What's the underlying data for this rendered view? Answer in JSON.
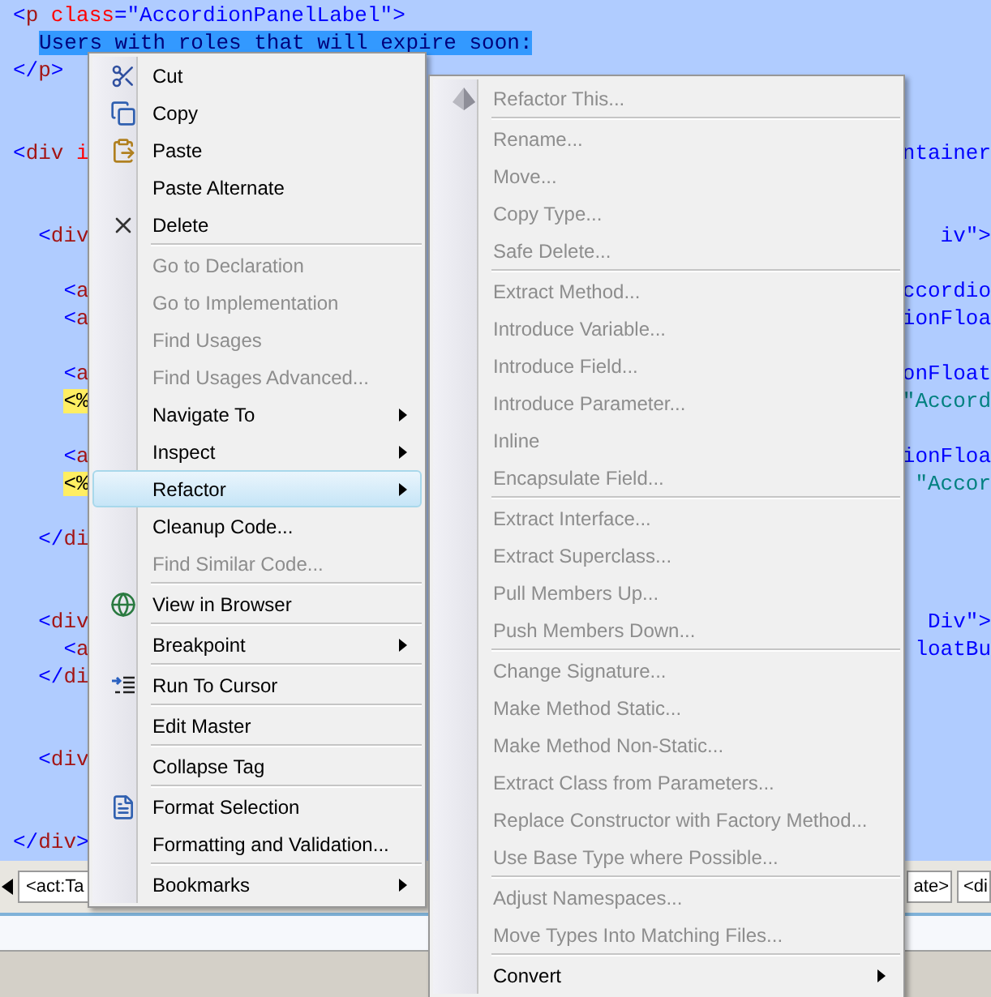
{
  "editor": {
    "lines": [
      {
        "kind": "code",
        "left": [
          {
            "kind": "punct",
            "text": "<"
          },
          {
            "kind": "tag",
            "text": "p"
          },
          {
            "kind": "attr",
            "text": " class"
          },
          {
            "kind": "punct",
            "text": "="
          },
          {
            "kind": "value",
            "text": "\"AccordionPanelLabel\""
          },
          {
            "kind": "punct",
            "text": ">"
          }
        ]
      },
      {
        "kind": "code",
        "indented": true,
        "left": [
          {
            "kind": "selected",
            "text": "Users with roles that will expire soon:"
          }
        ]
      },
      {
        "kind": "code",
        "left": [
          {
            "kind": "punct",
            "text": "</"
          },
          {
            "kind": "tag",
            "text": "p"
          },
          {
            "kind": "punct",
            "text": ">"
          }
        ]
      },
      {
        "kind": "blank"
      },
      {
        "kind": "blank"
      },
      {
        "kind": "code",
        "left": [
          {
            "kind": "punct",
            "text": "<"
          },
          {
            "kind": "tag",
            "text": "div"
          },
          {
            "kind": "attr",
            "text": " i"
          }
        ],
        "right": [
          {
            "kind": "value",
            "text": "ntainer"
          }
        ]
      },
      {
        "kind": "blank"
      },
      {
        "kind": "blank"
      },
      {
        "kind": "code",
        "left": [
          {
            "kind": "punct",
            "text": "  <"
          },
          {
            "kind": "tag",
            "text": "div"
          }
        ],
        "right": [
          {
            "kind": "value",
            "text": "iv\">"
          }
        ]
      },
      {
        "kind": "blank"
      },
      {
        "kind": "code",
        "left": [
          {
            "kind": "punct",
            "text": "    <"
          },
          {
            "kind": "tag",
            "text": "a"
          }
        ],
        "right": [
          {
            "kind": "value",
            "text": "ccordio"
          }
        ]
      },
      {
        "kind": "code",
        "left": [
          {
            "kind": "punct",
            "text": "    <"
          },
          {
            "kind": "tag",
            "text": "a"
          }
        ],
        "right": [
          {
            "kind": "value",
            "text": "ionFloa"
          }
        ]
      },
      {
        "kind": "blank"
      },
      {
        "kind": "code",
        "left": [
          {
            "kind": "punct",
            "text": "    <"
          },
          {
            "kind": "tag",
            "text": "a"
          }
        ],
        "right": [
          {
            "kind": "value",
            "text": "onFloat"
          }
        ]
      },
      {
        "kind": "code",
        "left": [
          {
            "kind": "server",
            "text": "    <%"
          }
        ],
        "right": [
          {
            "kind": "string",
            "text": "\"Accord"
          }
        ]
      },
      {
        "kind": "blank"
      },
      {
        "kind": "code",
        "left": [
          {
            "kind": "punct",
            "text": "    <"
          },
          {
            "kind": "tag",
            "text": "a"
          }
        ],
        "right": [
          {
            "kind": "value",
            "text": "ionFloa"
          }
        ]
      },
      {
        "kind": "code",
        "left": [
          {
            "kind": "server",
            "text": "    <%"
          }
        ],
        "right": [
          {
            "kind": "string",
            "text": "\"Accor"
          }
        ]
      },
      {
        "kind": "blank"
      },
      {
        "kind": "code",
        "left": [
          {
            "kind": "punct",
            "text": "  </"
          },
          {
            "kind": "tag",
            "text": "di"
          }
        ]
      },
      {
        "kind": "blank"
      },
      {
        "kind": "blank"
      },
      {
        "kind": "code",
        "left": [
          {
            "kind": "punct",
            "text": "  <"
          },
          {
            "kind": "tag",
            "text": "div"
          }
        ],
        "right": [
          {
            "kind": "value",
            "text": "Div\">"
          }
        ]
      },
      {
        "kind": "code",
        "left": [
          {
            "kind": "punct",
            "text": "    <"
          },
          {
            "kind": "tag",
            "text": "a"
          }
        ],
        "right": [
          {
            "kind": "value",
            "text": "loatBu"
          }
        ]
      },
      {
        "kind": "code",
        "left": [
          {
            "kind": "punct",
            "text": "  </"
          },
          {
            "kind": "tag",
            "text": "di"
          }
        ]
      },
      {
        "kind": "blank"
      },
      {
        "kind": "blank"
      },
      {
        "kind": "code",
        "left": [
          {
            "kind": "punct",
            "text": "  <"
          },
          {
            "kind": "tag",
            "text": "div"
          }
        ]
      },
      {
        "kind": "blank"
      },
      {
        "kind": "blank"
      },
      {
        "kind": "code",
        "left": [
          {
            "kind": "punct",
            "text": "</"
          },
          {
            "kind": "tag",
            "text": "div"
          },
          {
            "kind": "punct",
            "text": ">"
          }
        ]
      }
    ]
  },
  "tag_bar": {
    "left_tag": "<act:Ta",
    "right_tags": [
      "ate>",
      "<di"
    ]
  },
  "context_menu": {
    "items": [
      {
        "kind": "item",
        "label": "Cut",
        "disabled": false,
        "selected": false,
        "submenu": false
      },
      {
        "kind": "item",
        "label": "Copy",
        "disabled": false,
        "selected": false,
        "submenu": false
      },
      {
        "kind": "item",
        "label": "Paste",
        "disabled": false,
        "selected": false,
        "submenu": false
      },
      {
        "kind": "item",
        "label": "Paste Alternate",
        "disabled": false,
        "selected": false,
        "submenu": false
      },
      {
        "kind": "item",
        "label": "Delete",
        "disabled": false,
        "selected": false,
        "submenu": false
      },
      {
        "kind": "separator"
      },
      {
        "kind": "item",
        "label": "Go to Declaration",
        "disabled": true,
        "selected": false,
        "submenu": false
      },
      {
        "kind": "item",
        "label": "Go to Implementation",
        "disabled": true,
        "selected": false,
        "submenu": false
      },
      {
        "kind": "item",
        "label": "Find Usages",
        "disabled": true,
        "selected": false,
        "submenu": false
      },
      {
        "kind": "item",
        "label": "Find Usages Advanced...",
        "disabled": true,
        "selected": false,
        "submenu": false
      },
      {
        "kind": "item",
        "label": "Navigate To",
        "disabled": false,
        "selected": false,
        "submenu": true
      },
      {
        "kind": "item",
        "label": "Inspect",
        "disabled": false,
        "selected": false,
        "submenu": true
      },
      {
        "kind": "item",
        "label": "Refactor",
        "disabled": false,
        "selected": true,
        "submenu": true
      },
      {
        "kind": "item",
        "label": "Cleanup Code...",
        "disabled": false,
        "selected": false,
        "submenu": false
      },
      {
        "kind": "item",
        "label": "Find Similar Code...",
        "disabled": true,
        "selected": false,
        "submenu": false
      },
      {
        "kind": "separator"
      },
      {
        "kind": "item",
        "label": "View in Browser",
        "disabled": false,
        "selected": false,
        "submenu": false
      },
      {
        "kind": "separator"
      },
      {
        "kind": "item",
        "label": "Breakpoint",
        "disabled": false,
        "selected": false,
        "submenu": true
      },
      {
        "kind": "separator"
      },
      {
        "kind": "item",
        "label": "Run To Cursor",
        "disabled": false,
        "selected": false,
        "submenu": false
      },
      {
        "kind": "separator"
      },
      {
        "kind": "item",
        "label": "Edit Master",
        "disabled": false,
        "selected": false,
        "submenu": false
      },
      {
        "kind": "separator"
      },
      {
        "kind": "item",
        "label": "Collapse Tag",
        "disabled": false,
        "selected": false,
        "submenu": false
      },
      {
        "kind": "separator"
      },
      {
        "kind": "item",
        "label": "Format Selection",
        "disabled": false,
        "selected": false,
        "submenu": false
      },
      {
        "kind": "item",
        "label": "Formatting and Validation...",
        "disabled": false,
        "selected": false,
        "submenu": false
      },
      {
        "kind": "separator"
      },
      {
        "kind": "item",
        "label": "Bookmarks",
        "disabled": false,
        "selected": false,
        "submenu": true
      }
    ]
  },
  "refactor_submenu": {
    "items": [
      {
        "kind": "item",
        "label": "Refactor This...",
        "disabled": true,
        "selected": false,
        "submenu": false
      },
      {
        "kind": "separator"
      },
      {
        "kind": "item",
        "label": "Rename...",
        "disabled": true,
        "selected": false,
        "submenu": false
      },
      {
        "kind": "item",
        "label": "Move...",
        "disabled": true,
        "selected": false,
        "submenu": false
      },
      {
        "kind": "item",
        "label": "Copy Type...",
        "disabled": true,
        "selected": false,
        "submenu": false
      },
      {
        "kind": "item",
        "label": "Safe Delete...",
        "disabled": true,
        "selected": false,
        "submenu": false
      },
      {
        "kind": "separator"
      },
      {
        "kind": "item",
        "label": "Extract Method...",
        "disabled": true,
        "selected": false,
        "submenu": false
      },
      {
        "kind": "item",
        "label": "Introduce Variable...",
        "disabled": true,
        "selected": false,
        "submenu": false
      },
      {
        "kind": "item",
        "label": "Introduce Field...",
        "disabled": true,
        "selected": false,
        "submenu": false
      },
      {
        "kind": "item",
        "label": "Introduce Parameter...",
        "disabled": true,
        "selected": false,
        "submenu": false
      },
      {
        "kind": "item",
        "label": "Inline",
        "disabled": true,
        "selected": false,
        "submenu": false
      },
      {
        "kind": "item",
        "label": "Encapsulate Field...",
        "disabled": true,
        "selected": false,
        "submenu": false
      },
      {
        "kind": "separator"
      },
      {
        "kind": "item",
        "label": "Extract Interface...",
        "disabled": true,
        "selected": false,
        "submenu": false
      },
      {
        "kind": "item",
        "label": "Extract Superclass...",
        "disabled": true,
        "selected": false,
        "submenu": false
      },
      {
        "kind": "item",
        "label": "Pull Members Up...",
        "disabled": true,
        "selected": false,
        "submenu": false
      },
      {
        "kind": "item",
        "label": "Push Members Down...",
        "disabled": true,
        "selected": false,
        "submenu": false
      },
      {
        "kind": "separator"
      },
      {
        "kind": "item",
        "label": "Change Signature...",
        "disabled": true,
        "selected": false,
        "submenu": false
      },
      {
        "kind": "item",
        "label": "Make Method Static...",
        "disabled": true,
        "selected": false,
        "submenu": false
      },
      {
        "kind": "item",
        "label": "Make Method Non-Static...",
        "disabled": true,
        "selected": false,
        "submenu": false
      },
      {
        "kind": "item",
        "label": "Extract Class from Parameters...",
        "disabled": true,
        "selected": false,
        "submenu": false
      },
      {
        "kind": "item",
        "label": "Replace Constructor with Factory Method...",
        "disabled": true,
        "selected": false,
        "submenu": false
      },
      {
        "kind": "item",
        "label": "Use Base Type where Possible...",
        "disabled": true,
        "selected": false,
        "submenu": false
      },
      {
        "kind": "separator"
      },
      {
        "kind": "item",
        "label": "Adjust Namespaces...",
        "disabled": true,
        "selected": false,
        "submenu": false
      },
      {
        "kind": "item",
        "label": "Move Types Into Matching Files...",
        "disabled": true,
        "selected": false,
        "submenu": false
      },
      {
        "kind": "separator"
      },
      {
        "kind": "item",
        "label": "Convert",
        "disabled": false,
        "selected": false,
        "submenu": true
      }
    ]
  }
}
